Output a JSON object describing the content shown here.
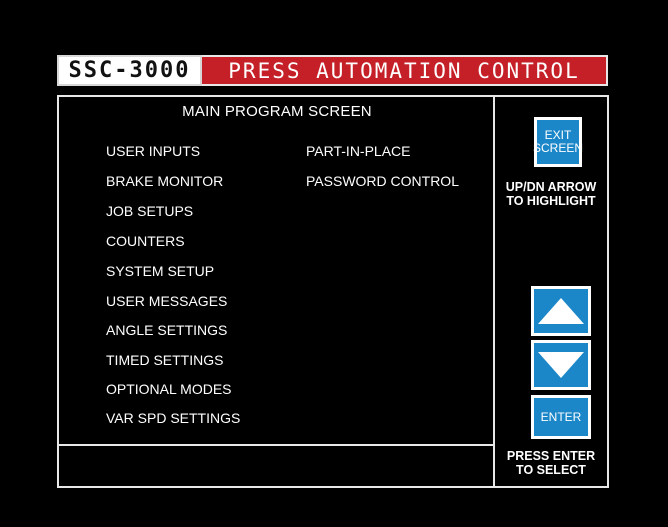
{
  "banner": {
    "model": "SSC-3000",
    "title": "PRESS AUTOMATION CONTROL"
  },
  "main": {
    "title": "MAIN PROGRAM SCREEN",
    "menu_left": [
      "USER INPUTS",
      "BRAKE MONITOR",
      "JOB SETUPS",
      "COUNTERS",
      "SYSTEM SETUP",
      "USER MESSAGES",
      "ANGLE SETTINGS",
      "TIMED SETTINGS",
      "OPTIONAL MODES",
      "VAR SPD SETTINGS"
    ],
    "menu_right": [
      "PART-IN-PLACE",
      "PASSWORD CONTROL"
    ]
  },
  "side": {
    "exit_line1": "EXIT",
    "exit_line2": "SCREEN",
    "hint_top_line1": "UP/DN ARROW",
    "hint_top_line2": "TO HIGHLIGHT",
    "enter_label": "ENTER",
    "hint_bottom_line1": "PRESS ENTER",
    "hint_bottom_line2": "TO SELECT"
  },
  "colors": {
    "background": "#000000",
    "banner_red": "#c52027",
    "button_blue": "#1b86c8",
    "border_white": "#e8e8e8"
  }
}
